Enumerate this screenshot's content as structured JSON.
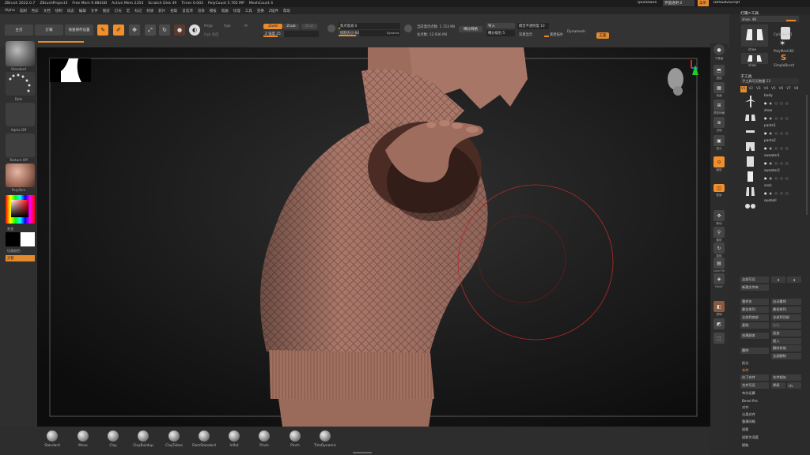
{
  "titlebar": {
    "items": [
      "ZBrush 2022.0.7",
      "ZBrushProject3",
      "Free Mem 9.884GB",
      "Active Mem 2354",
      "Scratch Disk 49",
      "Timer 0.002",
      "PolyCount 5.765 MP",
      "MeshCount 4"
    ],
    "quicksave": "QuickSave",
    "transparency": "界面透明 0",
    "menu_label": "菜单",
    "script": "DefaultZScript"
  },
  "menubar": [
    "Alpha",
    "笔刷",
    "色彩",
    "文档",
    "绘制",
    "动态",
    "编辑",
    "文件",
    "图层",
    "灯光",
    "宏",
    "标记",
    "材质",
    "影片",
    "拾取",
    "首选项",
    "渲染",
    "模板",
    "笔触",
    "纹理",
    "工具",
    "变换",
    "Z插件",
    "帮助"
  ],
  "topshelf": {
    "home": "主页",
    "light": "灯箱",
    "quick": "快速保存设置",
    "edit": "Edit",
    "draw": "Draw",
    "move": "Move",
    "scale": "Scale",
    "rotate": "Rotate",
    "mrgb": "Mrgb",
    "rgb": "Rgb",
    "m": "M",
    "rgb_intensity": "Rgb 强度",
    "zadd": "Zadd",
    "zsub": "Zsub",
    "zcut": "Zcut",
    "z_intensity": "Z 强度 25",
    "focal": "焦点衰减 0",
    "draw_size": "绘制大小 64",
    "dynamic": "Dynamic",
    "active_points": "当前激活点数: 1.723 Mil",
    "total_points": "总点数: 12.936 Mil",
    "dynamesh": "细分网格",
    "smooth_groups": "导入",
    "subdiv": "细分级别 5",
    "dynamesh_res": "模型不透明度 10",
    "ghost": "双重显示",
    "dynamesh_label": "Dynamesh",
    "rebuild": "重建拓扑",
    "reset": "正面"
  },
  "leftshelf": {
    "brush": "Standard",
    "stroke": "Dots",
    "alpha": "Alpha Off",
    "texture": "Texture Off",
    "material": "PolySkin",
    "gradient": "渐变",
    "switch": "切换颜色",
    "alternate": "交替"
  },
  "bottombrushes": [
    "Standard",
    "Move",
    "Clay",
    "ClayBuildup",
    "ClayTubes",
    "DamStandard",
    "Inflat",
    "Pinch",
    "Pinch",
    "TrimDynamic"
  ],
  "rightshelf": [
    "子集画",
    "透视",
    "地面",
    "透视网格",
    "当地",
    "显示",
    "缩放",
    "框架",
    "帧",
    "移动",
    "缩放",
    "旋转",
    "Line Fill",
    "PolyF",
    "透明",
    "双影",
    "固体"
  ],
  "tray": {
    "title": "灯箱>工具",
    "current": "shoe. 48",
    "tools": [
      "shoe",
      "Cylinder3D",
      "shoe",
      "PolyMesh3D",
      "SimpleBrush"
    ],
    "subtool_header": "子工具",
    "subtool_count": "子工具可见数量 13",
    "tabs": [
      "V1",
      "V2",
      "V3",
      "V4",
      "V5",
      "V6",
      "V7",
      "V8"
    ],
    "subtools": [
      "body",
      "shoe",
      "pants1",
      "pants2",
      "sweater1",
      "sweater2",
      "sock",
      "eyeball"
    ],
    "actions": [
      [
        "全部可见",
        "⬆",
        "⬇"
      ],
      [
        "新建文件夹"
      ],
      [
        "重命名",
        "自动重排"
      ],
      [
        "最佳排列",
        "最低排列"
      ],
      [
        "全部到底部",
        "全部到顶部"
      ],
      [
        "复制",
        "粘贴"
      ],
      [
        "追加"
      ],
      [
        "创建副本",
        "插入"
      ],
      [
        "删除",
        "删除其他"
      ],
      [
        "全部删除"
      ],
      [
        "拆分"
      ],
      [
        "合并"
      ],
      [
        "向下合并",
        "合并相似"
      ],
      [
        "合并可见",
        "焊接",
        "Uv"
      ],
      [
        "布尔运算"
      ],
      [
        "Bevel Pro"
      ],
      [
        "对齐"
      ],
      [
        "分离对齐"
      ],
      [
        "重建网格"
      ],
      [
        "投影"
      ],
      [
        "投影为深度"
      ],
      [
        "提取"
      ]
    ]
  },
  "colors": {
    "accent": "#f08f2c",
    "skin": "#a9786a",
    "panel": "#2f2f2f",
    "viewport": "#151515"
  }
}
